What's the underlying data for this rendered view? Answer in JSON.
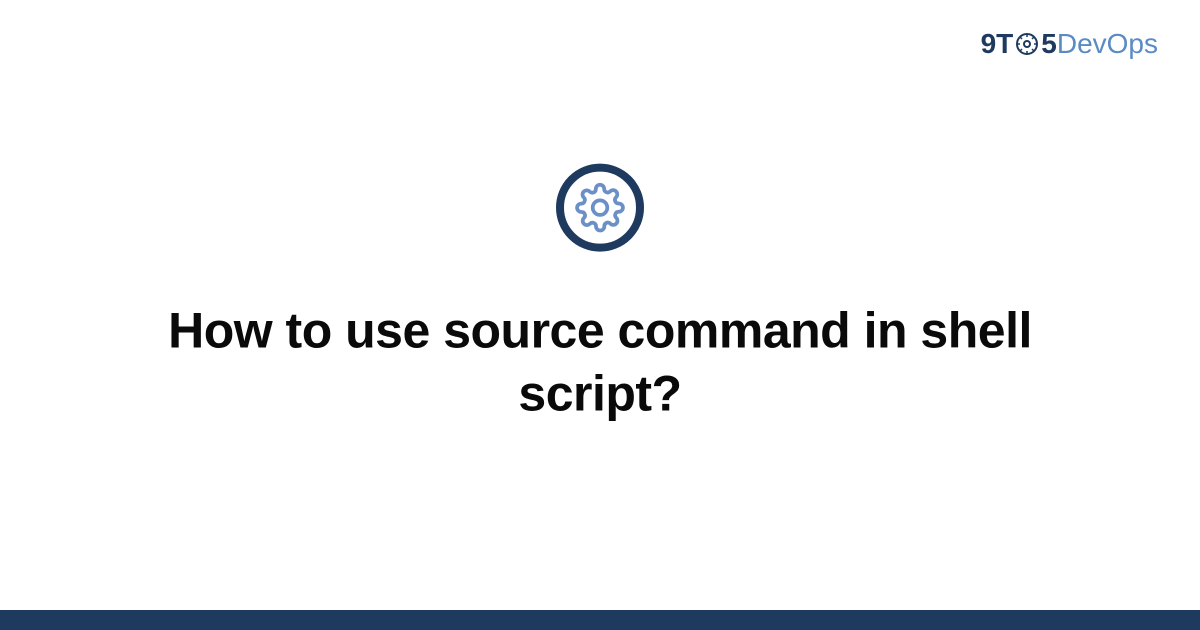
{
  "logo": {
    "part1": "9T",
    "part2": "5",
    "part3": "DevOps"
  },
  "title": "How to use source command in shell script?",
  "colors": {
    "brand_dark": "#1e3a5f",
    "brand_light": "#5a8bc4",
    "icon_gear": "#6b8fc7"
  }
}
